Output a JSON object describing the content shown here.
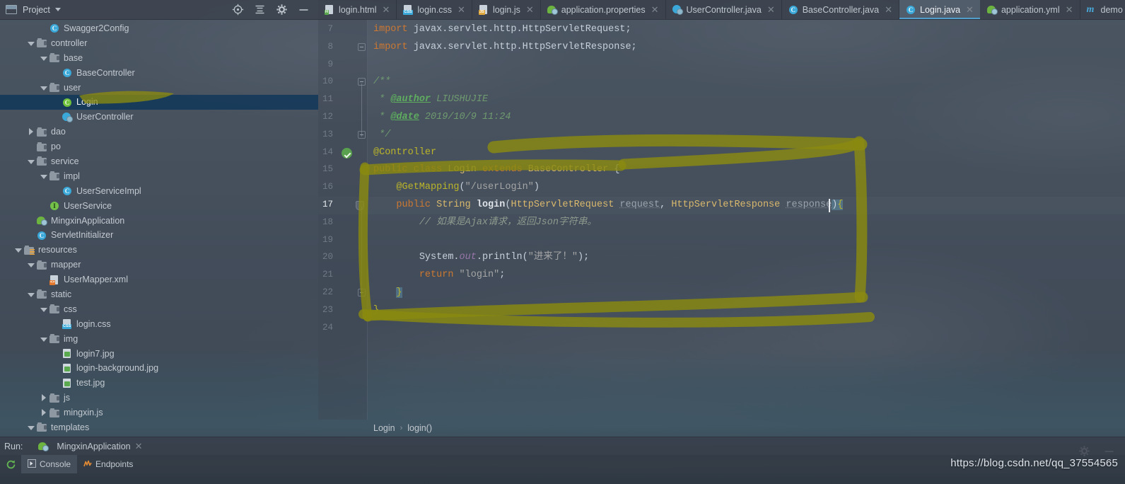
{
  "project_panel": {
    "title": "Project",
    "caret_icon": "chevron-down-icon",
    "tools": [
      {
        "name": "locate-icon",
        "label": "Select Opened File"
      },
      {
        "name": "collapse-all-icon",
        "label": "Collapse All"
      },
      {
        "name": "gear-icon",
        "label": "Settings"
      },
      {
        "name": "minimize-icon",
        "label": "Hide"
      }
    ],
    "tree": [
      {
        "label": "Swagger2Config",
        "depth": 4,
        "icon": "java-class-icon",
        "twisty": "none",
        "selected": false
      },
      {
        "label": "controller",
        "depth": 3,
        "icon": "folder-icon",
        "twisty": "down",
        "selected": false
      },
      {
        "label": "base",
        "depth": 4,
        "icon": "folder-icon",
        "twisty": "down",
        "selected": false
      },
      {
        "label": "BaseController",
        "depth": 5,
        "icon": "java-class-icon",
        "twisty": "none",
        "selected": false
      },
      {
        "label": "user",
        "depth": 4,
        "icon": "folder-icon",
        "twisty": "down",
        "selected": false
      },
      {
        "label": "Login",
        "depth": 5,
        "icon": "java-class-green-icon",
        "twisty": "none",
        "selected": true
      },
      {
        "label": "UserController",
        "depth": 5,
        "icon": "java-class-run-icon",
        "twisty": "none",
        "selected": false
      },
      {
        "label": "dao",
        "depth": 3,
        "icon": "folder-icon",
        "twisty": "right",
        "selected": false
      },
      {
        "label": "po",
        "depth": 3,
        "icon": "folder-icon",
        "twisty": "none",
        "selected": false
      },
      {
        "label": "service",
        "depth": 3,
        "icon": "folder-icon",
        "twisty": "down",
        "selected": false
      },
      {
        "label": "impl",
        "depth": 4,
        "icon": "folder-icon",
        "twisty": "down",
        "selected": false
      },
      {
        "label": "UserServiceImpl",
        "depth": 5,
        "icon": "java-class-icon",
        "twisty": "none",
        "selected": false
      },
      {
        "label": "UserService",
        "depth": 4,
        "icon": "java-interface-icon",
        "twisty": "none",
        "selected": false
      },
      {
        "label": "MingxinApplication",
        "depth": 3,
        "icon": "spring-boot-icon",
        "twisty": "none",
        "selected": false
      },
      {
        "label": "ServletInitializer",
        "depth": 3,
        "icon": "java-class-icon",
        "twisty": "none",
        "selected": false
      },
      {
        "label": "resources",
        "depth": 2,
        "icon": "resources-folder-icon",
        "twisty": "down",
        "selected": false
      },
      {
        "label": "mapper",
        "depth": 3,
        "icon": "folder-icon",
        "twisty": "down",
        "selected": false
      },
      {
        "label": "UserMapper.xml",
        "depth": 4,
        "icon": "xml-file-icon",
        "twisty": "none",
        "selected": false
      },
      {
        "label": "static",
        "depth": 3,
        "icon": "folder-icon",
        "twisty": "down",
        "selected": false
      },
      {
        "label": "css",
        "depth": 4,
        "icon": "folder-icon",
        "twisty": "down",
        "selected": false
      },
      {
        "label": "login.css",
        "depth": 5,
        "icon": "css-file-icon",
        "twisty": "none",
        "selected": false
      },
      {
        "label": "img",
        "depth": 4,
        "icon": "folder-icon",
        "twisty": "down",
        "selected": false
      },
      {
        "label": "login7.jpg",
        "depth": 5,
        "icon": "image-file-icon",
        "twisty": "none",
        "selected": false
      },
      {
        "label": "login-background.jpg",
        "depth": 5,
        "icon": "image-file-icon",
        "twisty": "none",
        "selected": false
      },
      {
        "label": "test.jpg",
        "depth": 5,
        "icon": "image-file-icon",
        "twisty": "none",
        "selected": false
      },
      {
        "label": "js",
        "depth": 4,
        "icon": "folder-icon",
        "twisty": "right",
        "selected": false
      },
      {
        "label": "mingxin.js",
        "depth": 4,
        "icon": "folder-icon",
        "twisty": "right",
        "selected": false
      },
      {
        "label": "templates",
        "depth": 3,
        "icon": "folder-icon",
        "twisty": "down",
        "selected": false
      }
    ]
  },
  "tabs": [
    {
      "label": "login.html",
      "icon": "html-file-icon",
      "badge": "H",
      "badge_color": "#5aa94e",
      "active": false,
      "closable": true
    },
    {
      "label": "login.css",
      "icon": "css-file-icon",
      "badge": "CSS",
      "badge_color": "#3aa8d8",
      "active": false,
      "closable": true
    },
    {
      "label": "login.js",
      "icon": "js-file-icon",
      "badge": "JS",
      "badge_color": "#e0a83c",
      "active": false,
      "closable": true
    },
    {
      "label": "application.properties",
      "icon": "spring-boot-icon",
      "badge": "",
      "badge_color": "#6db33f",
      "active": false,
      "closable": true
    },
    {
      "label": "UserController.java",
      "icon": "java-class-run-icon",
      "badge": "",
      "badge_color": "#3aa8d8",
      "active": false,
      "closable": true
    },
    {
      "label": "BaseController.java",
      "icon": "java-class-icon",
      "badge": "C",
      "badge_color": "#3aa8d8",
      "active": false,
      "closable": true
    },
    {
      "label": "Login.java",
      "icon": "java-class-icon",
      "badge": "C",
      "badge_color": "#3aa8d8",
      "active": true,
      "closable": true
    },
    {
      "label": "application.yml",
      "icon": "spring-boot-icon",
      "badge": "",
      "badge_color": "#6db33f",
      "active": false,
      "closable": true
    },
    {
      "label": "demo",
      "icon": "maven-module-icon",
      "badge": "m",
      "badge_color": "#49a8d8",
      "active": false,
      "closable": true
    }
  ],
  "editor": {
    "first_line": 7,
    "current_line": 17,
    "line_numbers": [
      7,
      8,
      9,
      10,
      11,
      12,
      13,
      14,
      15,
      16,
      17,
      18,
      19,
      20,
      21,
      22,
      23,
      24
    ],
    "code_lines": [
      "import javax.servlet.http.HttpServletRequest;",
      "import javax.servlet.http.HttpServletResponse;",
      "",
      "/**",
      " * @author LIUSHUJIE",
      " * @date 2019/10/9 11:24",
      " */",
      "@Controller",
      "public class Login extends BaseController {",
      "    @GetMapping(\"/userLogin\")",
      "    public String login(HttpServletRequest request, HttpServletResponse response) {",
      "        // 如果是Ajax请求，返回Json字符串。",
      "",
      "        System.out.println(\"进来了！\");",
      "        return \"login\";",
      "    }",
      "}",
      ""
    ],
    "gutter_markers": {
      "run_line": 14,
      "shield_line": 17
    },
    "breadcrumb": [
      "Login",
      "login()"
    ],
    "breadcrumb_separator": "›"
  },
  "editor_tools": [
    {
      "name": "gear-icon",
      "label": "Settings"
    },
    {
      "name": "minimize-icon",
      "label": "Hide"
    }
  ],
  "run_panel": {
    "run_label": "Run:",
    "configuration": "MingxinApplication",
    "configuration_icon": "spring-boot-icon",
    "close_icon": "close-icon",
    "rerun_icon": "rerun-icon",
    "tool_tabs": [
      {
        "label": "Console",
        "icon": "console-icon",
        "active": true
      },
      {
        "label": "Endpoints",
        "icon": "endpoints-icon",
        "active": false
      }
    ]
  },
  "watermark": "https://blog.csdn.net/qq_37554565",
  "colors": {
    "accent": "#4f9ecb",
    "selection": "#163a5a",
    "highlighter": "#8a8a10",
    "keyword": "#cc7832",
    "class_name": "#d9b86c",
    "annotation": "#bbb529",
    "string": "#a5a5a5",
    "comment": "#7f9a7f",
    "spring_green": "#6db33f"
  }
}
